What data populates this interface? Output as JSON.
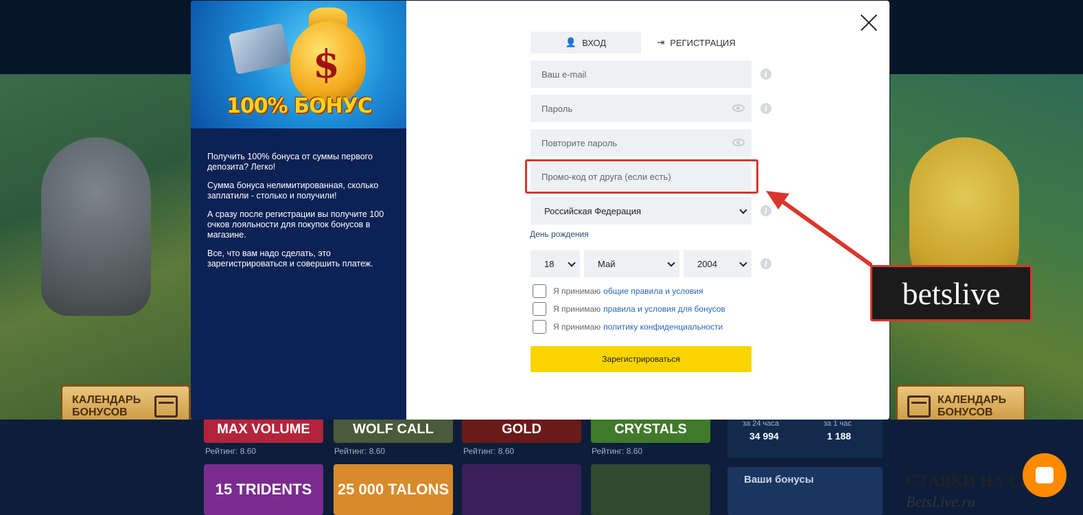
{
  "background": {
    "calendar_left": "КАЛЕНДАРЬ БОНУСОВ",
    "calendar_right": "КАЛЕНДАРЬ БОНУСОВ",
    "games": [
      {
        "title": "MAX VOLUME",
        "rating": "Рейтинг: 8.60",
        "color": "#b3243b"
      },
      {
        "title": "WOLF CALL",
        "rating": "Рейтинг: 8.60",
        "color": "#4a5a3a"
      },
      {
        "title": "GOLD",
        "rating": "Рейтинг: 8.60",
        "color": "#6b1a1a"
      },
      {
        "title": "CRYSTALS",
        "rating": "Рейтинг: 8.60",
        "color": "#3f7a2a"
      }
    ],
    "games_row2": [
      {
        "title": "15 TRIDENTS",
        "color": "#7a2c8e"
      },
      {
        "title": "25 000 TALONS",
        "color": "#d98a2a"
      },
      {
        "title": "",
        "color": "#3a1f5a"
      },
      {
        "title": "",
        "color": "#2f4a2f"
      }
    ],
    "stats": {
      "label_24h": "за 24 часа",
      "value_24h": "34 994",
      "label_1h": "за 1 час",
      "value_1h": "1 188"
    },
    "bonuses_title": "Ваши бонусы",
    "corner_text": "СТАВКИ НА СПОРТ",
    "corner_sub": "BetsLive.ru"
  },
  "promo": {
    "banner_text": "100% БОНУС",
    "paragraphs": [
      "Получить 100% бонуса от суммы первого депозита? Легко!",
      "Сумма бонуса нелимитированная, сколько заплатили - столько и получили!",
      "А сразу после регистрации вы получите 100 очков лояльности для покупок бонусов в магазине.",
      "Все, что вам надо сделать, это зарегистрироваться и совершить платеж."
    ]
  },
  "tabs": {
    "login": "ВХОД",
    "register": "РЕГИСТРАЦИЯ"
  },
  "form": {
    "email_placeholder": "Ваш e-mail",
    "password_placeholder": "Пароль",
    "password_repeat_placeholder": "Повторите пароль",
    "promo_placeholder": "Промо-код от друга (если есть)",
    "country_value": "Российская Федерация",
    "birthday_label": "День рождения",
    "birthday_day": "18",
    "birthday_month": "Май",
    "birthday_year": "2004",
    "accept_prefix": "Я принимаю",
    "accept_terms_link": "общие правила и условия",
    "accept_bonus_link": "правила и условия для бонусов",
    "accept_privacy_link": "политику конфиденциальности",
    "submit_label": "Зарегистрироваться"
  },
  "annotation": {
    "watermark": "betslive",
    "highlight_color": "#d9362b"
  }
}
